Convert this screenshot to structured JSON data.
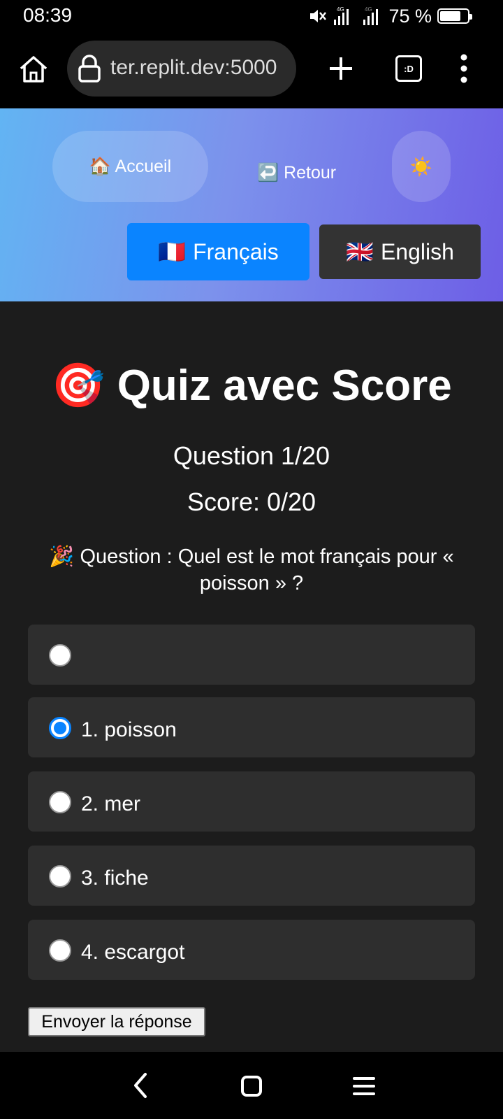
{
  "status_bar": {
    "time": "08:39",
    "network_label": "4G",
    "battery_text": "75 %",
    "battery_level": 0.75
  },
  "browser": {
    "url_text": "ter.replit.dev:5000",
    "tabs_count_label": ":D"
  },
  "header": {
    "accueil_label": "🏠 Accueil",
    "retour_label": "↩️ Retour",
    "theme_icon": "☀️",
    "lang_fr": {
      "flag": "🇫🇷",
      "label": "Français",
      "active": true
    },
    "lang_en": {
      "flag": "🇬🇧",
      "label": "English",
      "active": false
    }
  },
  "quiz": {
    "title": "🎯 Quiz avec Score",
    "question_counter": "Question 1/20",
    "score": "Score: 0/20",
    "question": "🎉 Question : Quel est le mot français pour « poisson » ?",
    "options": [
      {
        "label": "",
        "selected": false
      },
      {
        "label": "1. poisson",
        "selected": true
      },
      {
        "label": "2. mer",
        "selected": false
      },
      {
        "label": "3. fiche",
        "selected": false
      },
      {
        "label": "4. escargot",
        "selected": false
      }
    ],
    "submit_label": "Envoyer la réponse"
  },
  "colors": {
    "accent": "#0a84ff",
    "background": "#1c1c1c",
    "option_bg": "#2e2e2e",
    "gradient_start": "#62b4f3",
    "gradient_end": "#6d5ee6"
  }
}
